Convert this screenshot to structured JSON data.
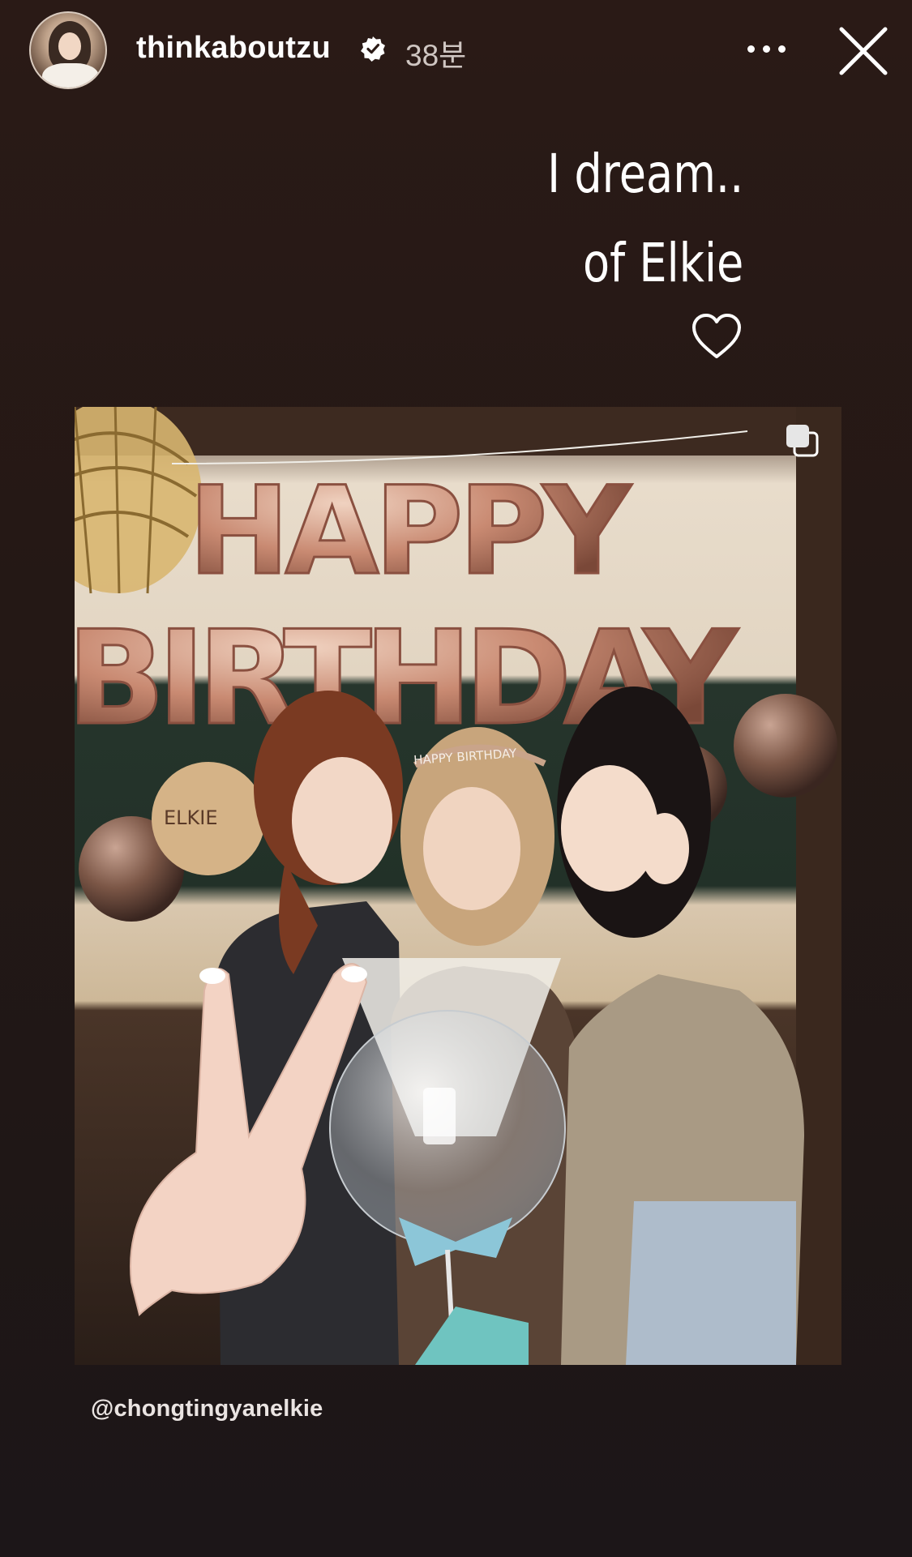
{
  "header": {
    "username": "thinkaboutzu",
    "timestamp": "38분",
    "avatar_icon": "profile-avatar",
    "verified_icon": "verified-badge-icon",
    "more_icon": "more-options-icon",
    "close_icon": "close-icon"
  },
  "caption": {
    "line1": "I dream..",
    "line2": "of Elkie",
    "heart": "♡"
  },
  "photo": {
    "balloon_top": "HAPPY",
    "balloon_bottom": "BIRTHDAY",
    "small_balloon_text": "ELKIE",
    "headband_text": "HAPPY BIRTHDAY",
    "multi_icon": "multiple-photos-icon"
  },
  "mention": "@chongtingyanelkie",
  "colors": {
    "background": "#231815",
    "text": "#ffffff",
    "timestamp": "#cfc6c2",
    "balloon": "#c98a72"
  }
}
